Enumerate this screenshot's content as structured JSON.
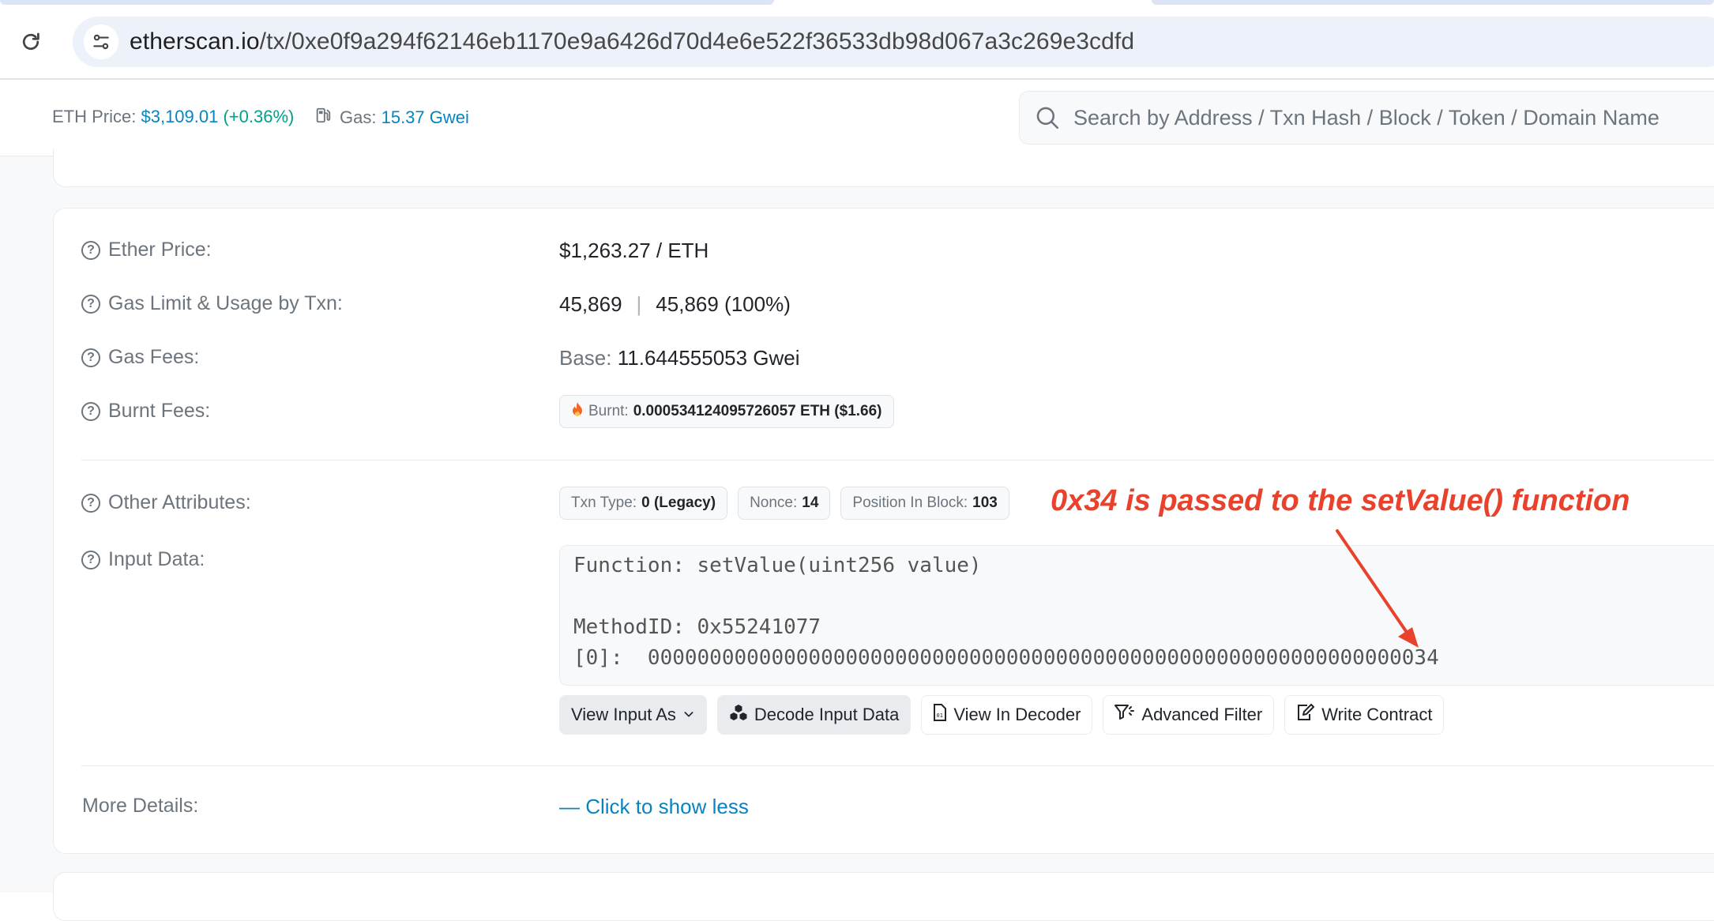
{
  "browser": {
    "url_host": "etherscan.io",
    "url_path": "/tx/0xe0f9a294f62146eb1170e9a6426d70d4e6e522f36533db98d067a3c269e3cdfd"
  },
  "header": {
    "eth_price_label": "ETH Price:",
    "eth_price_value": "$3,109.01",
    "eth_price_change": "(+0.36%)",
    "gas_label": "Gas:",
    "gas_value": "15.37 Gwei",
    "search_placeholder": "Search by Address / Txn Hash / Block / Token / Domain Name"
  },
  "details": {
    "ether_price": {
      "label": "Ether Price:",
      "value": "$1,263.27 / ETH"
    },
    "gas_limit": {
      "label": "Gas Limit & Usage by Txn:",
      "limit": "45,869",
      "usage": "45,869 (100%)"
    },
    "gas_fees": {
      "label": "Gas Fees:",
      "base_label": "Base:",
      "base_value": "11.644555053 Gwei"
    },
    "burnt_fees": {
      "label": "Burnt Fees:",
      "badge_label": "Burnt:",
      "badge_value": "0.000534124095726057 ETH ($1.66)"
    },
    "other_attributes": {
      "label": "Other Attributes:",
      "txn_type_label": "Txn Type:",
      "txn_type_value": "0 (Legacy)",
      "nonce_label": "Nonce:",
      "nonce_value": "14",
      "position_label": "Position In Block:",
      "position_value": "103"
    },
    "input_data": {
      "label": "Input Data:",
      "line_function": "Function: setValue(uint256 value)",
      "line_method": "MethodID: 0x55241077",
      "line_param": "[0]:  0000000000000000000000000000000000000000000000000000000000000034"
    },
    "buttons": {
      "view_input_as": "View Input As",
      "decode_input": "Decode Input Data",
      "view_in_decoder": "View In Decoder",
      "advanced_filter": "Advanced Filter",
      "write_contract": "Write Contract"
    },
    "more_details": {
      "label": "More Details:",
      "link": "— Click to show less"
    }
  },
  "annotation": {
    "text": "0x34 is passed to the setValue() function",
    "color": "#e8412c"
  },
  "colors": {
    "link": "#0784c3",
    "positive": "#00a186",
    "muted": "#6c757d"
  },
  "icons": [
    "reload-icon",
    "site-info-icon",
    "search-icon",
    "question-icon",
    "gas-pump-icon",
    "fire-icon",
    "chevron-down-icon",
    "cubes-icon",
    "decoder-icon",
    "filter-icon",
    "edit-icon"
  ]
}
